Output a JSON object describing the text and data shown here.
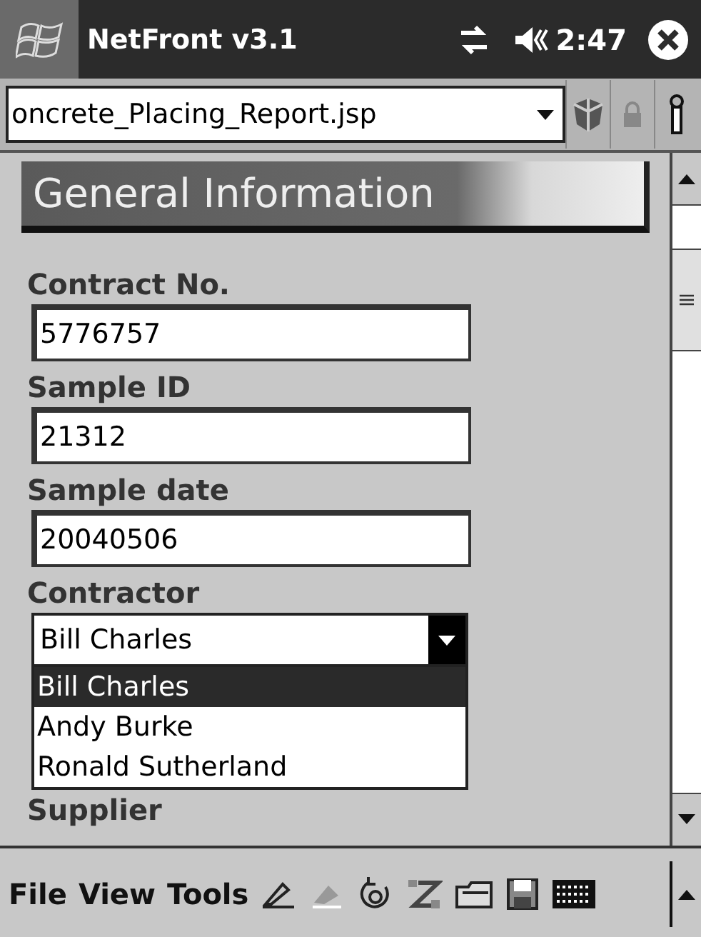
{
  "title_bar": {
    "title": "NetFront v3.1",
    "time": "2:47"
  },
  "address_bar": {
    "value": "oncrete_Placing_Report.jsp"
  },
  "banner": {
    "title": "General Information"
  },
  "fields": [
    {
      "label": "Contract No.",
      "value": "5776757"
    },
    {
      "label": "Sample ID",
      "value": "21312"
    },
    {
      "label": "Sample date",
      "value": "20040506"
    }
  ],
  "contractor": {
    "label": "Contractor",
    "value": "Bill Charles",
    "expanded": true,
    "options": [
      {
        "label": "Bill Charles",
        "selected": true
      },
      {
        "label": "Andy Burke",
        "selected": false
      },
      {
        "label": "Ronald Sutherland",
        "selected": false
      }
    ]
  },
  "next_label": "Supplier",
  "menu": [
    "File",
    "View",
    "Tools"
  ]
}
